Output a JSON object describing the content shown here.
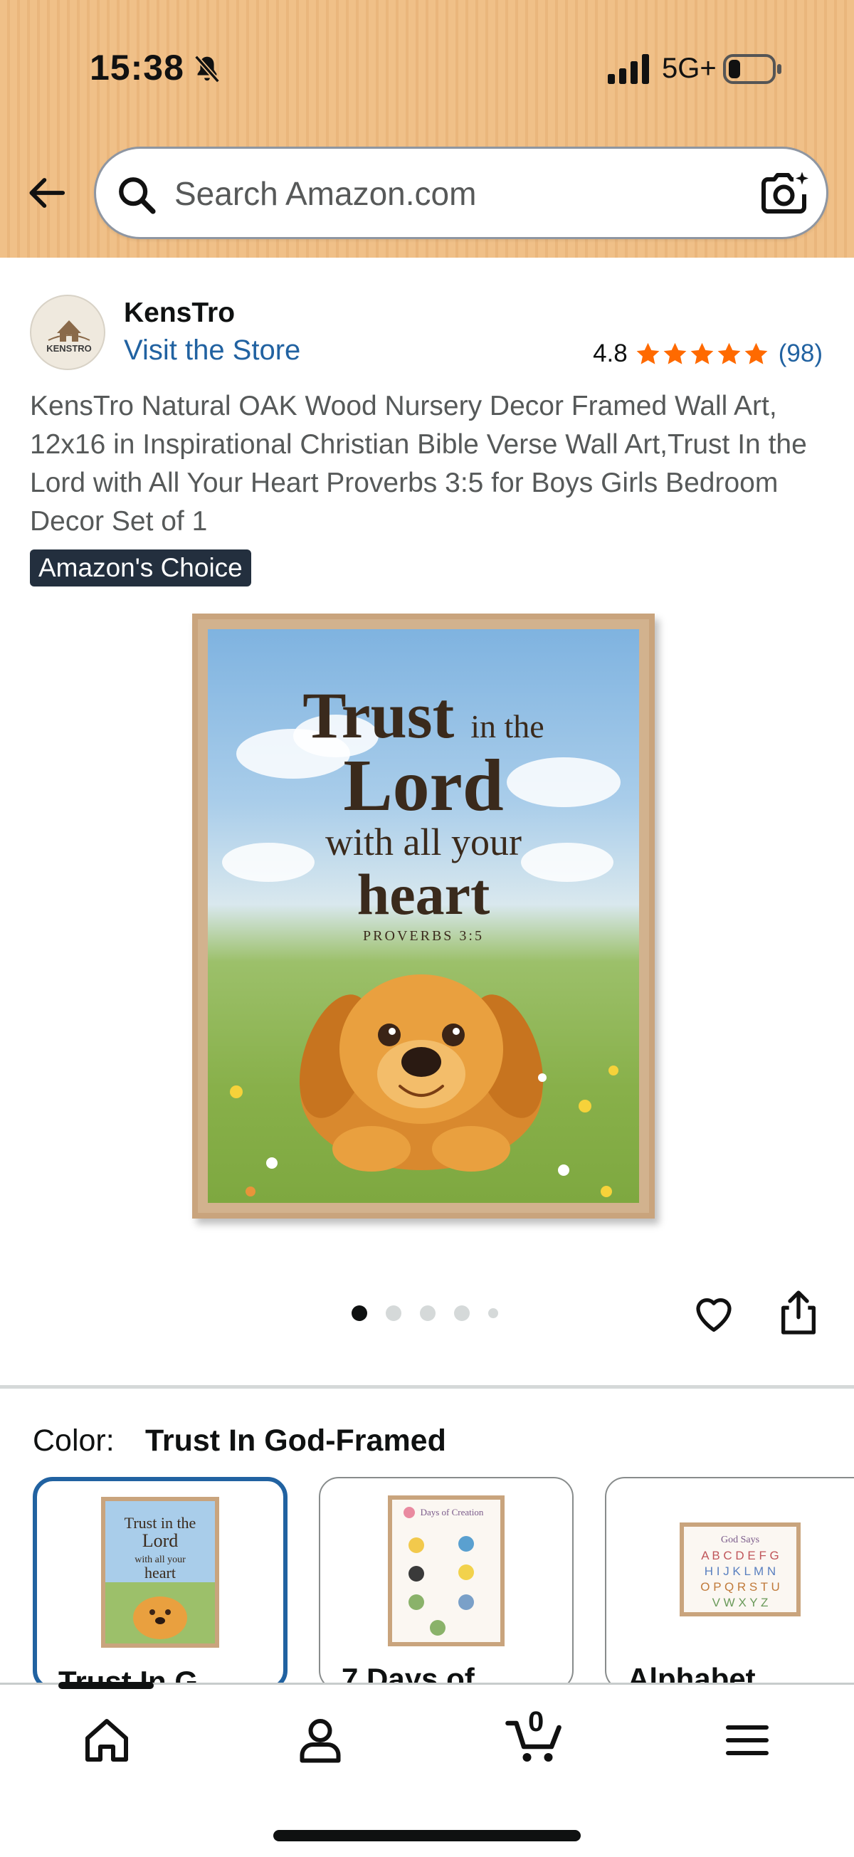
{
  "status_bar": {
    "time": "15:38",
    "network": "5G+"
  },
  "search": {
    "placeholder": "Search Amazon.com"
  },
  "seller": {
    "brand": "KensTro",
    "logo_text": "KENSTRO",
    "store_link": "Visit the Store",
    "rating": "4.8",
    "stars": 5,
    "review_count": "(98)"
  },
  "product": {
    "title": "KensTro Natural OAK Wood Nursery Decor Framed Wall Art, 12x16 in Inspirational Christian Bible Verse Wall Art,Trust In the Lord with All Your Heart Proverbs 3:5 for Boys Girls Bedroom Decor Set of 1",
    "badge": "Amazon's Choice",
    "image_text": {
      "line1_big": "Trust",
      "line1_small": "in the",
      "line2": "Lord",
      "line3": "with all your",
      "line4": "heart",
      "line5": "PROVERBS 3:5"
    },
    "image_count": 5,
    "current_image": 1
  },
  "variations": {
    "label": "Color:",
    "selected": "Trust In God-Framed",
    "options": [
      {
        "label": "Trust In G",
        "selected": true
      },
      {
        "label": "7 Days of",
        "selected": false
      },
      {
        "label": "Alphabet",
        "selected": false
      }
    ]
  },
  "bottom_nav": {
    "items": [
      "home-icon",
      "account-icon",
      "cart-icon",
      "menu-icon"
    ],
    "cart_count": "0"
  },
  "colors": {
    "header_bg": "#f0c088",
    "link": "#2162a1",
    "star": "#ff6a00",
    "badge_bg": "#232f3e",
    "selected_border": "#2162a1"
  }
}
